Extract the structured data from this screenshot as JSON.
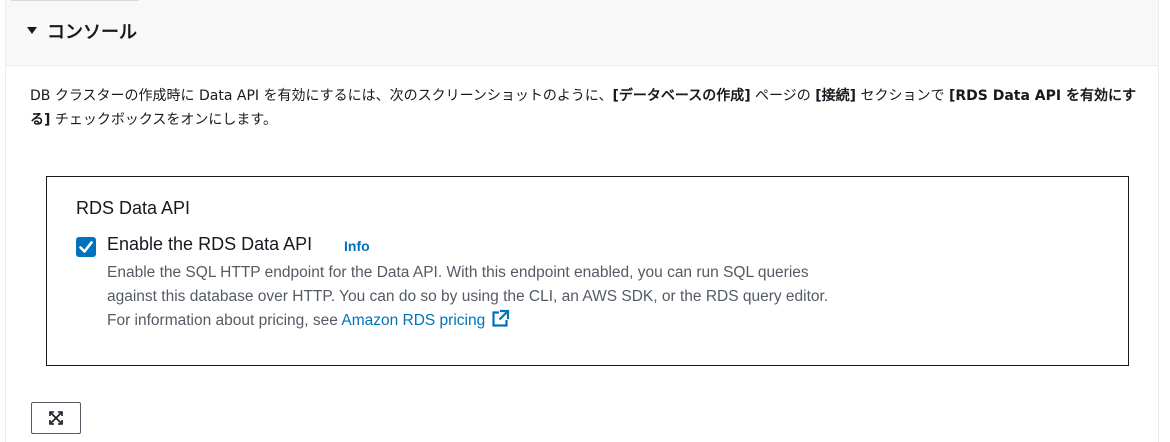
{
  "console_panel": {
    "title": "コンソール",
    "description": {
      "part1": "DB クラスターの作成時に Data API を有効にするには、次のスクリーンショットのように、",
      "bold1": "[データベースの作成]",
      "part2": " ページの ",
      "bold2": "[接続]",
      "part3": " セクションで ",
      "bold3": "[RDS Data API を有効にする]",
      "part4": " チェックボックスをオンにします。"
    }
  },
  "rds_screenshot": {
    "section_label": "RDS Data API",
    "option": {
      "checked": true,
      "label": "Enable the RDS Data API",
      "info_link": "Info",
      "description": "Enable the SQL HTTP endpoint for the Data API. With this endpoint enabled, you can run SQL queries against this database over HTTP. You can do so by using the CLI, an AWS SDK, or the RDS query editor. For information about pricing, see ",
      "pricing_link": "Amazon RDS pricing"
    }
  },
  "controls": {
    "expand_icon": "expand-icon"
  },
  "colors": {
    "accent": "#0073bb",
    "text": "#16191f",
    "muted_text": "#545b64",
    "header_bg": "#f8f8f8"
  }
}
